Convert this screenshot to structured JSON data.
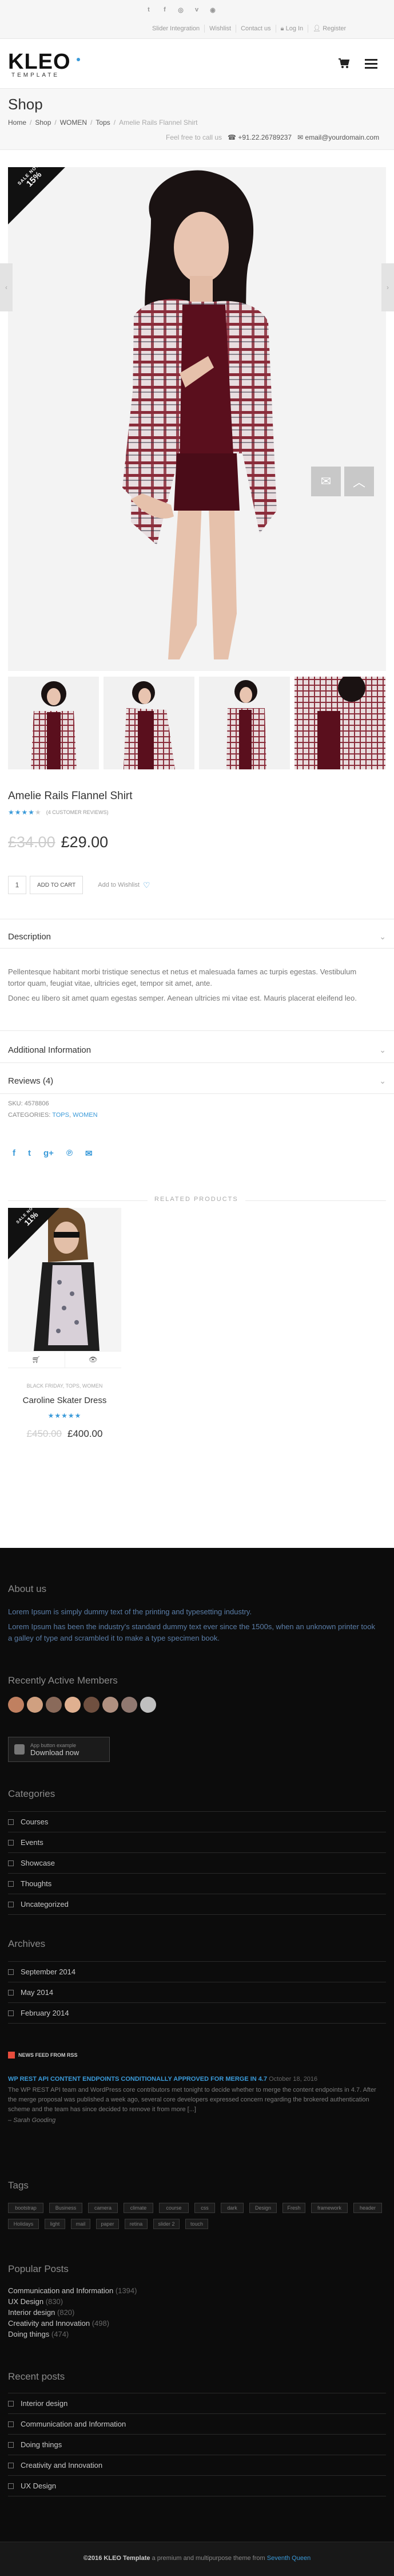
{
  "topbar": {
    "links": [
      "Slider Integration",
      "Wishlist",
      "Contact us"
    ],
    "login": "Log In",
    "register": "Register"
  },
  "header": {
    "logo": "KLEO",
    "logo_sub": "TEMPLATE"
  },
  "title_bar": {
    "title": "Shop",
    "breadcrumb": [
      "Home",
      "Shop",
      "WOMEN",
      "Tops",
      "Amelie Rails Flannel Shirt"
    ],
    "call": "Feel free to call us",
    "phone": "+91.22.26789237",
    "email": "email@yourdomain.com"
  },
  "product": {
    "badge_line1": "SALE NOW",
    "badge_line2": "15%",
    "name": "Amelie Rails Flannel Shirt",
    "rating": 4,
    "reviews_link": "(4 CUSTOMER REVIEWS)",
    "old_price": "£34.00",
    "price": "£29.00",
    "quantity": "1",
    "add_to_cart": "ADD TO CART",
    "add_to_wishlist": "Add to Wishlist",
    "description_title": "Description",
    "description_p1": "Pellentesque habitant morbi tristique senectus et netus et malesuada fames ac turpis egestas. Vestibulum tortor quam, feugiat vitae, ultricies eget, tempor sit amet, ante.",
    "description_p2": "Donec eu libero sit amet quam egestas semper. Aenean ultricies mi vitae est. Mauris placerat eleifend leo.",
    "additional_title": "Additional Information",
    "reviews_title": "Reviews (4)",
    "sku_label": "SKU:",
    "sku": "4578806",
    "categories_label": "CATEGORIES:",
    "categories": [
      "TOPS",
      "WOMEN"
    ]
  },
  "related": {
    "heading": "RELATED PRODUCTS",
    "badge_line1": "SALE NOW",
    "badge_line2": "11%",
    "cats": "BLACK FRIDAY, TOPS, WOMEN",
    "name": "Caroline Skater Dress",
    "rating": 5,
    "old_price": "£450.00",
    "price": "£400.00"
  },
  "footer": {
    "about_title": "About us",
    "about_p1": "Lorem Ipsum is simply dummy text of the printing and typesetting industry.",
    "about_p2": "Lorem Ipsum has been the industry's standard dummy text ever since the 1500s, when an unknown printer took a galley of type and scrambled it to make a type specimen book.",
    "members_title": "Recently Active Members",
    "app_small": "App button example",
    "app_big": "Download now",
    "categories_title": "Categories",
    "categories": [
      "Courses",
      "Events",
      "Showcase",
      "Thoughts",
      "Uncategorized"
    ],
    "archives_title": "Archives",
    "archives": [
      "September 2014",
      "May 2014",
      "February 2014"
    ],
    "rss_title": "NEWS FEED FROM RSS",
    "rss_headline": "WP REST API CONTENT ENDPOINTS CONDITIONALLY APPROVED FOR MERGE IN 4.7",
    "rss_date": "October 18, 2016",
    "rss_body": "The WP REST API team and WordPress core contributors met tonight to decide whether to merge the content endpoints in 4.7. After the merge proposal was published a week ago, several core developers expressed concern regarding the brokered authentication scheme and the team has since decided to remove it from more [...]",
    "rss_author": "Sarah Gooding",
    "tags_title": "Tags",
    "tags": [
      "bootstrap",
      "Business",
      "camera",
      "climate",
      "course",
      "css",
      "dark",
      "Design",
      "Fresh",
      "framework",
      "header",
      "Holidays",
      "light",
      "mail",
      "paper",
      "retina",
      "slider 2",
      "touch"
    ],
    "popular_title": "Popular Posts",
    "popular": [
      {
        "name": "Communication and Information",
        "count": "(1394)"
      },
      {
        "name": "UX Design",
        "count": "(830)"
      },
      {
        "name": "Interior design",
        "count": "(820)"
      },
      {
        "name": "Creativity and Innovation",
        "count": "(498)"
      },
      {
        "name": "Doing things",
        "count": "(474)"
      }
    ],
    "recent_title": "Recent posts",
    "recent": [
      "Interior design",
      "Communication and Information",
      "Doing things",
      "Creativity and Innovation",
      "UX Design"
    ],
    "copyright_brand": "©2016 KLEO Template",
    "copyright_rest": "a premium and multipurpose theme from",
    "copyright_author": "Seventh Queen"
  },
  "colors": {
    "accent": "#3a9ad9",
    "dark": "#0c0c0c",
    "price": "#333333",
    "red": "#e74c3c"
  }
}
